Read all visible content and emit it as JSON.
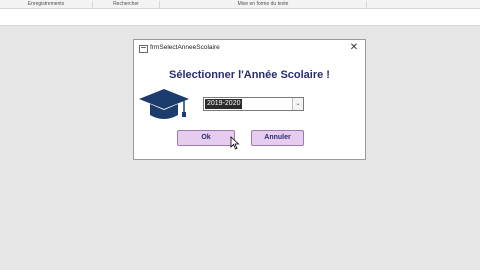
{
  "ribbon": {
    "groups": [
      "Enregistrements",
      "Rechercher",
      "Mise en forme du texte"
    ]
  },
  "dialog": {
    "title": "frmSelectAnneeScolaire",
    "close_glyph": "✕",
    "heading": "Sélectionner l'Année Scolaire !",
    "icon": "graduation-cap-icon",
    "combo": {
      "value": "2019-2020",
      "arrow_glyph": "⌄"
    },
    "ok_label": "Ok",
    "cancel_label": "Annuler"
  },
  "colors": {
    "heading": "#2a2d6e",
    "button_bg": "#e6cdef",
    "icon": "#1d3c6e"
  }
}
